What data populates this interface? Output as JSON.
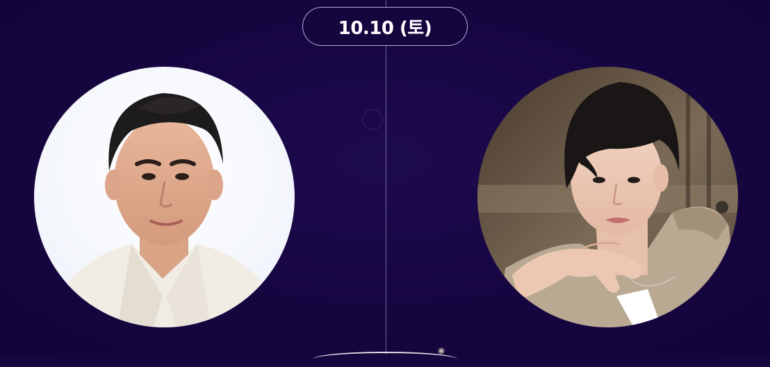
{
  "event": {
    "date_label": "10.10 (토)"
  },
  "portraits": [
    {
      "icon": "person-photo",
      "position": "left"
    },
    {
      "icon": "person-photo",
      "position": "right"
    }
  ]
}
